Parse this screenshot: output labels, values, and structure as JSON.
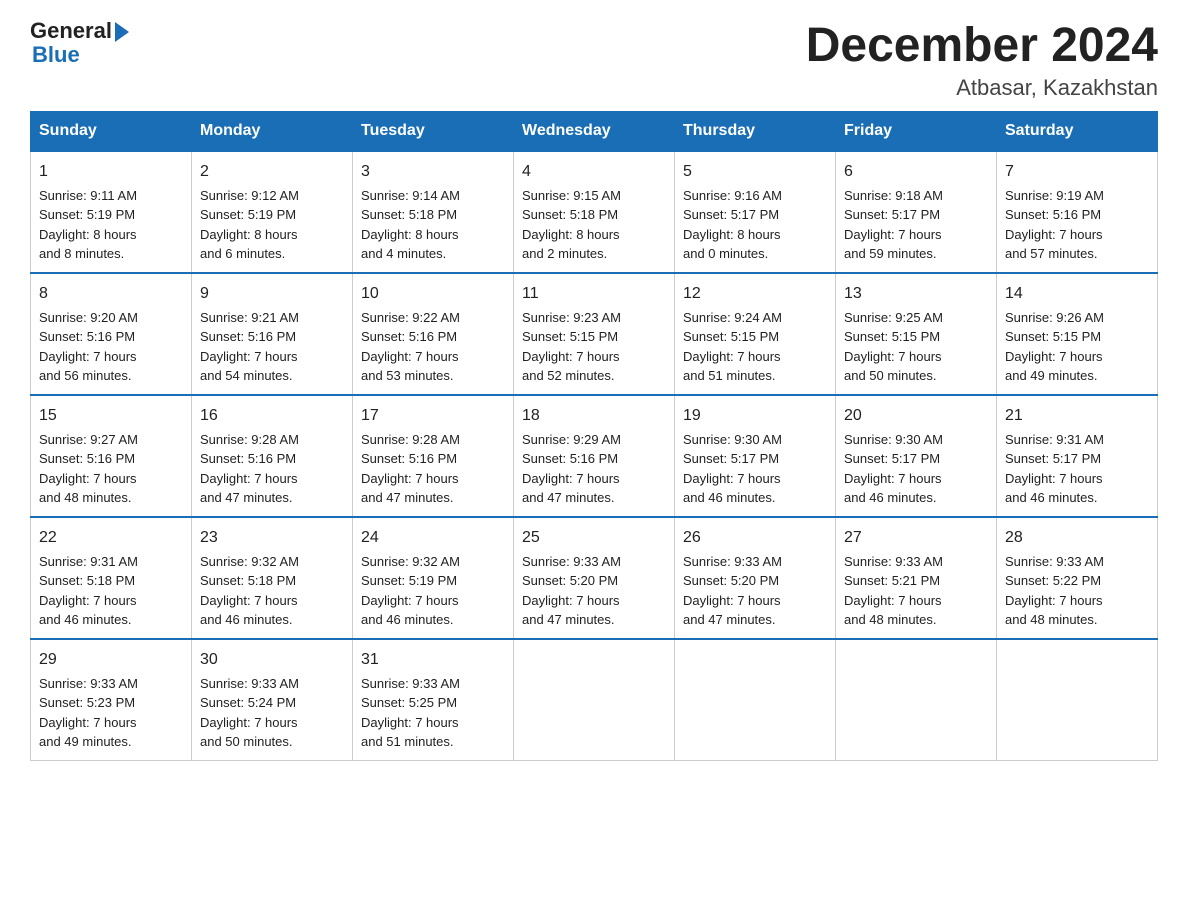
{
  "logo": {
    "part1": "General",
    "part2": "Blue"
  },
  "title": "December 2024",
  "location": "Atbasar, Kazakhstan",
  "weekdays": [
    "Sunday",
    "Monday",
    "Tuesday",
    "Wednesday",
    "Thursday",
    "Friday",
    "Saturday"
  ],
  "weeks": [
    [
      {
        "day": "1",
        "info": "Sunrise: 9:11 AM\nSunset: 5:19 PM\nDaylight: 8 hours\nand 8 minutes."
      },
      {
        "day": "2",
        "info": "Sunrise: 9:12 AM\nSunset: 5:19 PM\nDaylight: 8 hours\nand 6 minutes."
      },
      {
        "day": "3",
        "info": "Sunrise: 9:14 AM\nSunset: 5:18 PM\nDaylight: 8 hours\nand 4 minutes."
      },
      {
        "day": "4",
        "info": "Sunrise: 9:15 AM\nSunset: 5:18 PM\nDaylight: 8 hours\nand 2 minutes."
      },
      {
        "day": "5",
        "info": "Sunrise: 9:16 AM\nSunset: 5:17 PM\nDaylight: 8 hours\nand 0 minutes."
      },
      {
        "day": "6",
        "info": "Sunrise: 9:18 AM\nSunset: 5:17 PM\nDaylight: 7 hours\nand 59 minutes."
      },
      {
        "day": "7",
        "info": "Sunrise: 9:19 AM\nSunset: 5:16 PM\nDaylight: 7 hours\nand 57 minutes."
      }
    ],
    [
      {
        "day": "8",
        "info": "Sunrise: 9:20 AM\nSunset: 5:16 PM\nDaylight: 7 hours\nand 56 minutes."
      },
      {
        "day": "9",
        "info": "Sunrise: 9:21 AM\nSunset: 5:16 PM\nDaylight: 7 hours\nand 54 minutes."
      },
      {
        "day": "10",
        "info": "Sunrise: 9:22 AM\nSunset: 5:16 PM\nDaylight: 7 hours\nand 53 minutes."
      },
      {
        "day": "11",
        "info": "Sunrise: 9:23 AM\nSunset: 5:15 PM\nDaylight: 7 hours\nand 52 minutes."
      },
      {
        "day": "12",
        "info": "Sunrise: 9:24 AM\nSunset: 5:15 PM\nDaylight: 7 hours\nand 51 minutes."
      },
      {
        "day": "13",
        "info": "Sunrise: 9:25 AM\nSunset: 5:15 PM\nDaylight: 7 hours\nand 50 minutes."
      },
      {
        "day": "14",
        "info": "Sunrise: 9:26 AM\nSunset: 5:15 PM\nDaylight: 7 hours\nand 49 minutes."
      }
    ],
    [
      {
        "day": "15",
        "info": "Sunrise: 9:27 AM\nSunset: 5:16 PM\nDaylight: 7 hours\nand 48 minutes."
      },
      {
        "day": "16",
        "info": "Sunrise: 9:28 AM\nSunset: 5:16 PM\nDaylight: 7 hours\nand 47 minutes."
      },
      {
        "day": "17",
        "info": "Sunrise: 9:28 AM\nSunset: 5:16 PM\nDaylight: 7 hours\nand 47 minutes."
      },
      {
        "day": "18",
        "info": "Sunrise: 9:29 AM\nSunset: 5:16 PM\nDaylight: 7 hours\nand 47 minutes."
      },
      {
        "day": "19",
        "info": "Sunrise: 9:30 AM\nSunset: 5:17 PM\nDaylight: 7 hours\nand 46 minutes."
      },
      {
        "day": "20",
        "info": "Sunrise: 9:30 AM\nSunset: 5:17 PM\nDaylight: 7 hours\nand 46 minutes."
      },
      {
        "day": "21",
        "info": "Sunrise: 9:31 AM\nSunset: 5:17 PM\nDaylight: 7 hours\nand 46 minutes."
      }
    ],
    [
      {
        "day": "22",
        "info": "Sunrise: 9:31 AM\nSunset: 5:18 PM\nDaylight: 7 hours\nand 46 minutes."
      },
      {
        "day": "23",
        "info": "Sunrise: 9:32 AM\nSunset: 5:18 PM\nDaylight: 7 hours\nand 46 minutes."
      },
      {
        "day": "24",
        "info": "Sunrise: 9:32 AM\nSunset: 5:19 PM\nDaylight: 7 hours\nand 46 minutes."
      },
      {
        "day": "25",
        "info": "Sunrise: 9:33 AM\nSunset: 5:20 PM\nDaylight: 7 hours\nand 47 minutes."
      },
      {
        "day": "26",
        "info": "Sunrise: 9:33 AM\nSunset: 5:20 PM\nDaylight: 7 hours\nand 47 minutes."
      },
      {
        "day": "27",
        "info": "Sunrise: 9:33 AM\nSunset: 5:21 PM\nDaylight: 7 hours\nand 48 minutes."
      },
      {
        "day": "28",
        "info": "Sunrise: 9:33 AM\nSunset: 5:22 PM\nDaylight: 7 hours\nand 48 minutes."
      }
    ],
    [
      {
        "day": "29",
        "info": "Sunrise: 9:33 AM\nSunset: 5:23 PM\nDaylight: 7 hours\nand 49 minutes."
      },
      {
        "day": "30",
        "info": "Sunrise: 9:33 AM\nSunset: 5:24 PM\nDaylight: 7 hours\nand 50 minutes."
      },
      {
        "day": "31",
        "info": "Sunrise: 9:33 AM\nSunset: 5:25 PM\nDaylight: 7 hours\nand 51 minutes."
      },
      null,
      null,
      null,
      null
    ]
  ]
}
